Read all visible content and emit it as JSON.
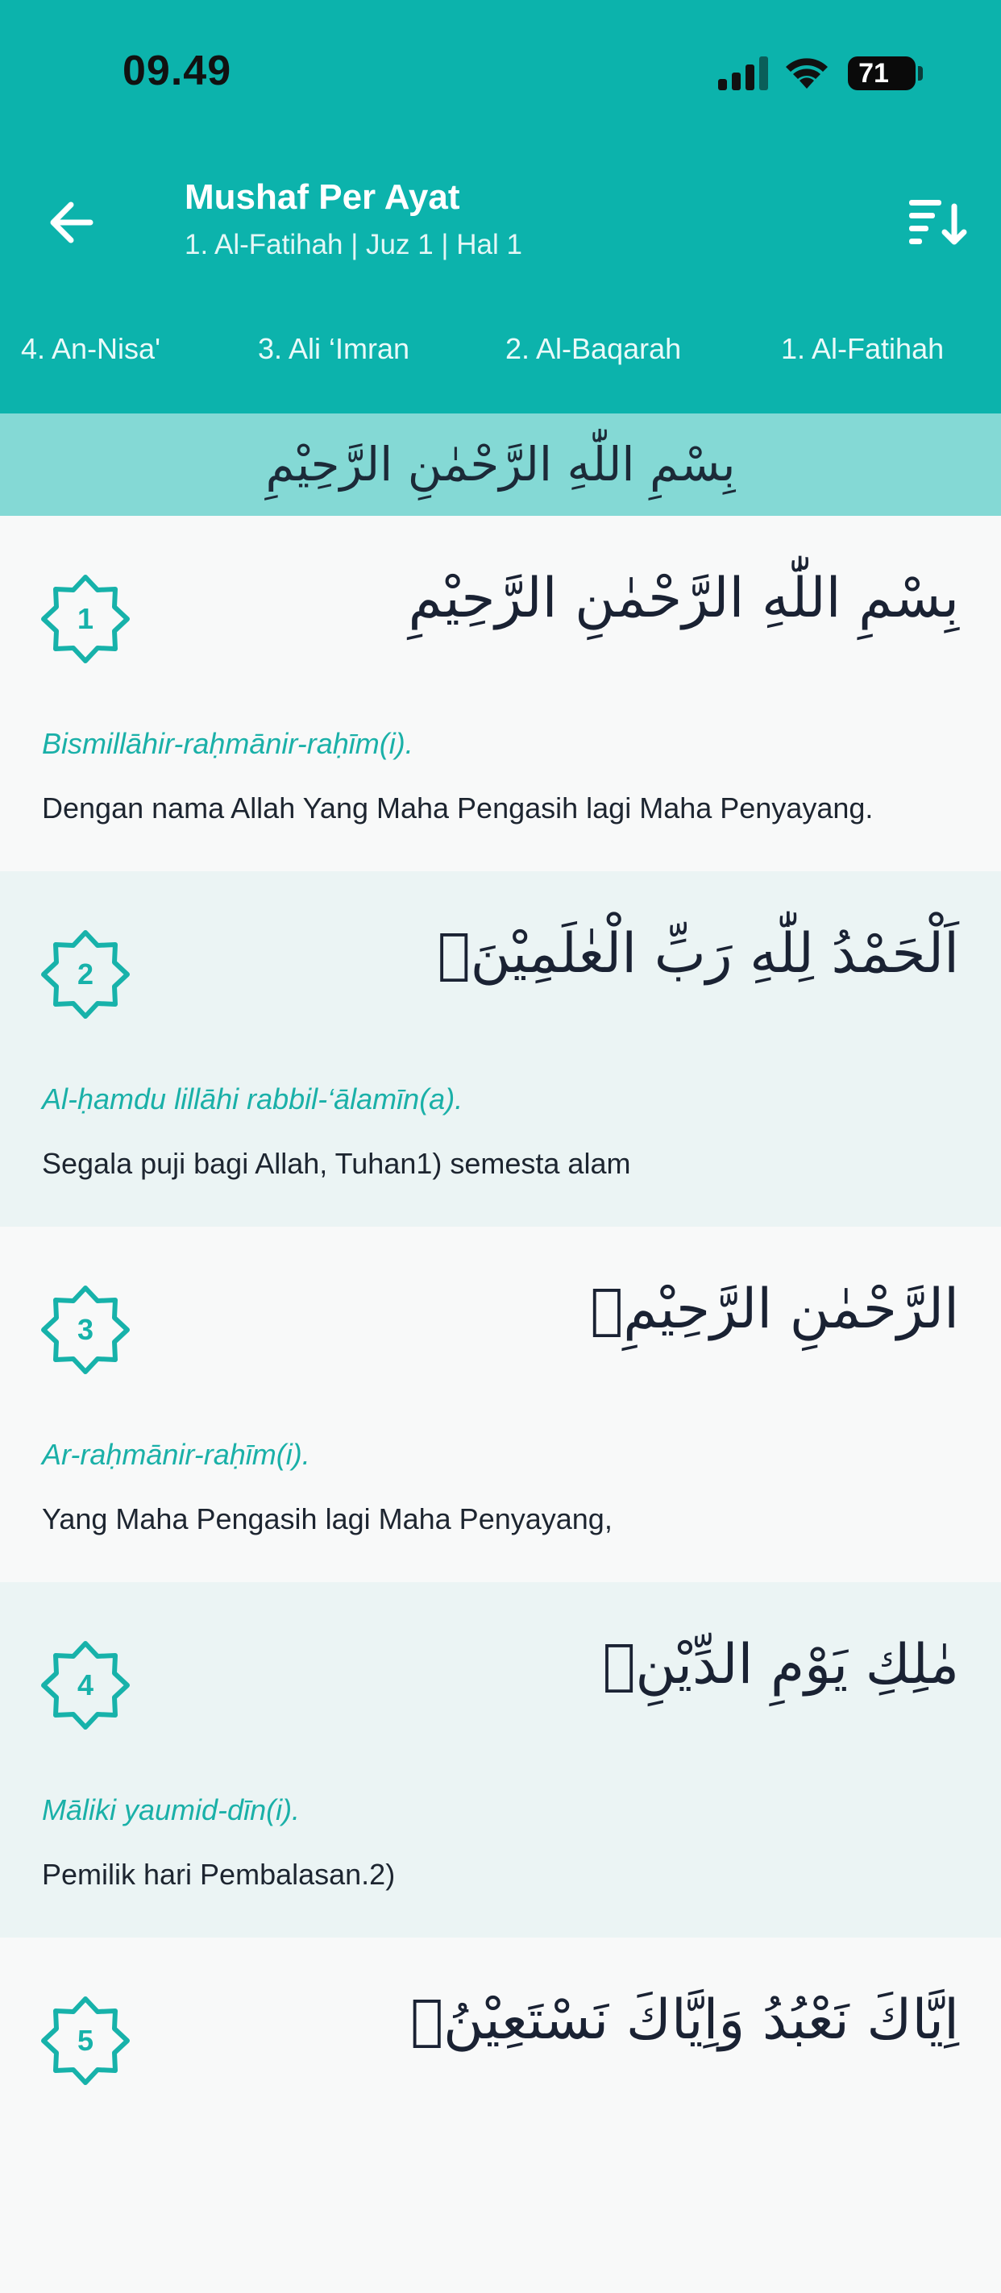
{
  "status_bar": {
    "time": "09.49",
    "battery": "71"
  },
  "header": {
    "title": "Mushaf Per Ayat",
    "subtitle": "1. Al-Fatihah | Juz 1 | Hal 1",
    "back_icon": "arrow-left-icon",
    "sort_icon": "sort-descending-icon"
  },
  "tabs": [
    {
      "label": "4. An-Nisa'"
    },
    {
      "label": "3. Ali ‘Imran"
    },
    {
      "label": "2. Al-Baqarah"
    },
    {
      "label": "1. Al-Fatihah"
    }
  ],
  "bismillah": "بِسْمِ اللّٰهِ الرَّحْمٰنِ الرَّحِيْمِ",
  "colors": {
    "primary": "#0cb3ac",
    "accent": "#1ab0a8",
    "bismillah_bar": "#84d9d5",
    "alt_row": "#ebf4f4"
  },
  "ayahs": [
    {
      "number": "1",
      "arabic": "بِسْمِ اللّٰهِ الرَّحْمٰنِ الرَّحِيْمِ",
      "latin": "Bismillāhir-raḥmānir-raḥīm(i).",
      "translation": "Dengan nama Allah Yang Maha Pengasih lagi Maha Penyayang."
    },
    {
      "number": "2",
      "arabic": "اَلْحَمْدُ لِلّٰهِ رَبِّ الْعٰلَمِيْنَۙ",
      "latin": "Al-ḥamdu lillāhi rabbil-‘ālamīn(a).",
      "translation": "Segala puji bagi Allah, Tuhan1) semesta alam"
    },
    {
      "number": "3",
      "arabic": "الرَّحْمٰنِ الرَّحِيْمِۙ",
      "latin": "Ar-raḥmānir-raḥīm(i).",
      "translation": "Yang Maha Pengasih lagi Maha Penyayang,"
    },
    {
      "number": "4",
      "arabic": "مٰلِكِ يَوْمِ الدِّيْنِۗ",
      "latin": "Māliki yaumid-dīn(i).",
      "translation": "Pemilik hari Pembalasan.2)"
    },
    {
      "number": "5",
      "arabic": "اِيَّاكَ نَعْبُدُ وَاِيَّاكَ نَسْتَعِيْنُۗ",
      "latin": "",
      "translation": ""
    }
  ]
}
